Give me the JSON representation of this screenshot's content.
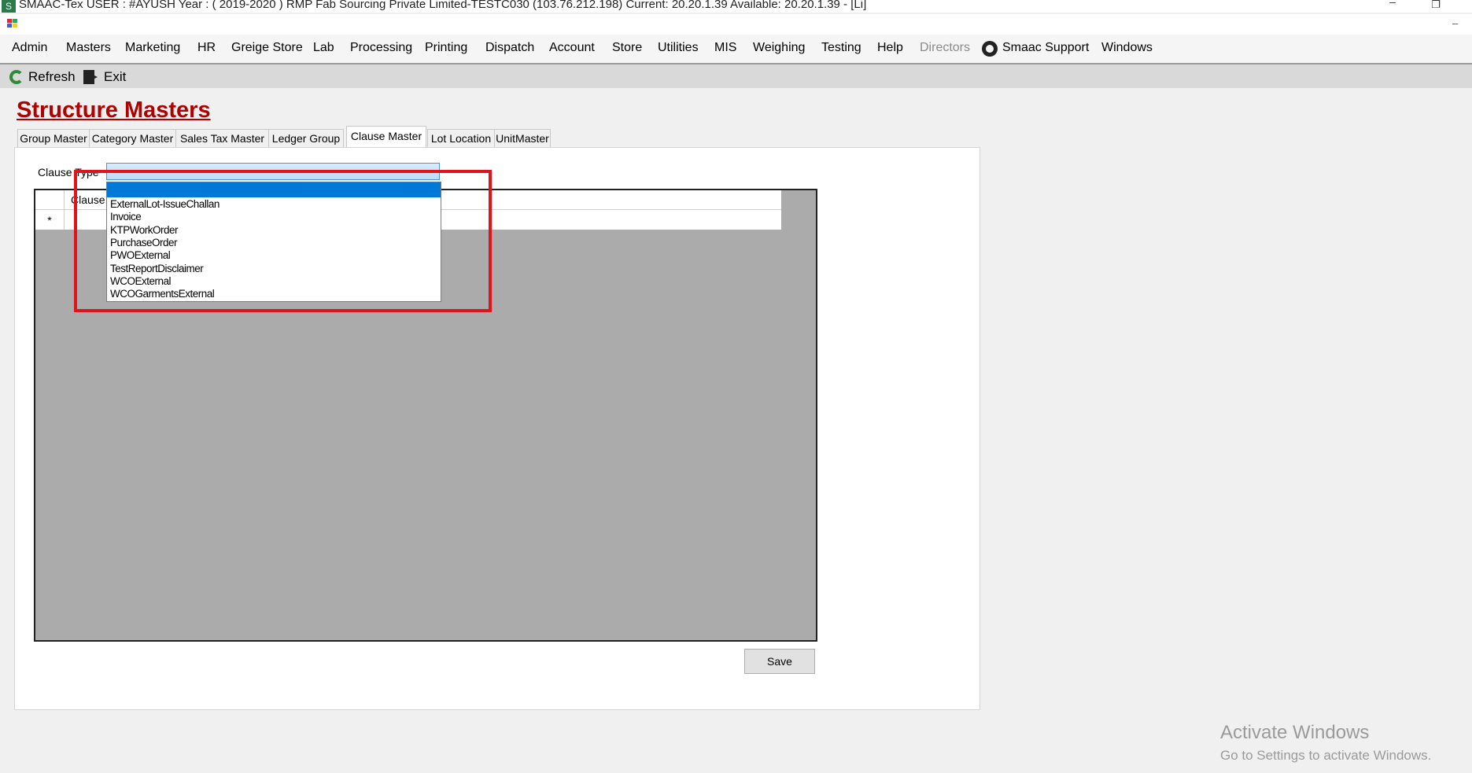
{
  "window": {
    "title": "SMAAC-Tex  USER : #AYUSH  Year : ( 2019-2020 )   RMP Fab Sourcing Private Limited-TESTC030 (103.76.212.198)  Current: 20.20.1.39  Available: 20.20.1.39  - [Li]",
    "minimize_glyph": "–",
    "restore_glyph": "❐",
    "mdi_minimize_glyph": "–"
  },
  "menu": {
    "items": [
      "Admin",
      "Masters",
      "Marketing",
      "HR",
      "Greige Store",
      "Lab",
      "Processing",
      "Printing",
      "Dispatch",
      "Account",
      "Store",
      "Utilities",
      "MIS",
      "Weighing",
      "Testing",
      "Help",
      "Directors",
      "Smaac Support",
      "Windows"
    ]
  },
  "toolbar": {
    "refresh_label": "Refresh",
    "exit_label": "Exit"
  },
  "page": {
    "title": "Structure Masters"
  },
  "tabs": [
    "Group Master",
    "Category Master",
    "Sales Tax Master",
    "Ledger Group",
    "Clause Master",
    "Lot Location",
    "UnitMaster"
  ],
  "active_tab": "Clause Master",
  "form": {
    "clause_type_label": "Clause Type",
    "clause_type_value": "",
    "dropdown_options": [
      "",
      "ExternalLot-IssueChallan",
      "Invoice",
      "KTPWorkOrder",
      "PurchaseOrder",
      "PWOExternal",
      "TestReportDisclaimer",
      "WCOExternal",
      "WCOGarmentsExternal"
    ],
    "selected_option_index": 0
  },
  "grid": {
    "columns": [
      "Clause"
    ],
    "new_row_marker": "*"
  },
  "actions": {
    "save_label": "Save"
  },
  "watermark": {
    "title": "Activate Windows",
    "subtitle": "Go to Settings to activate Windows."
  },
  "colors": {
    "title_red": "#b00000",
    "highlight_red": "#e0141c",
    "selection_blue": "#0078d7",
    "grid_bg": "#ababab"
  }
}
